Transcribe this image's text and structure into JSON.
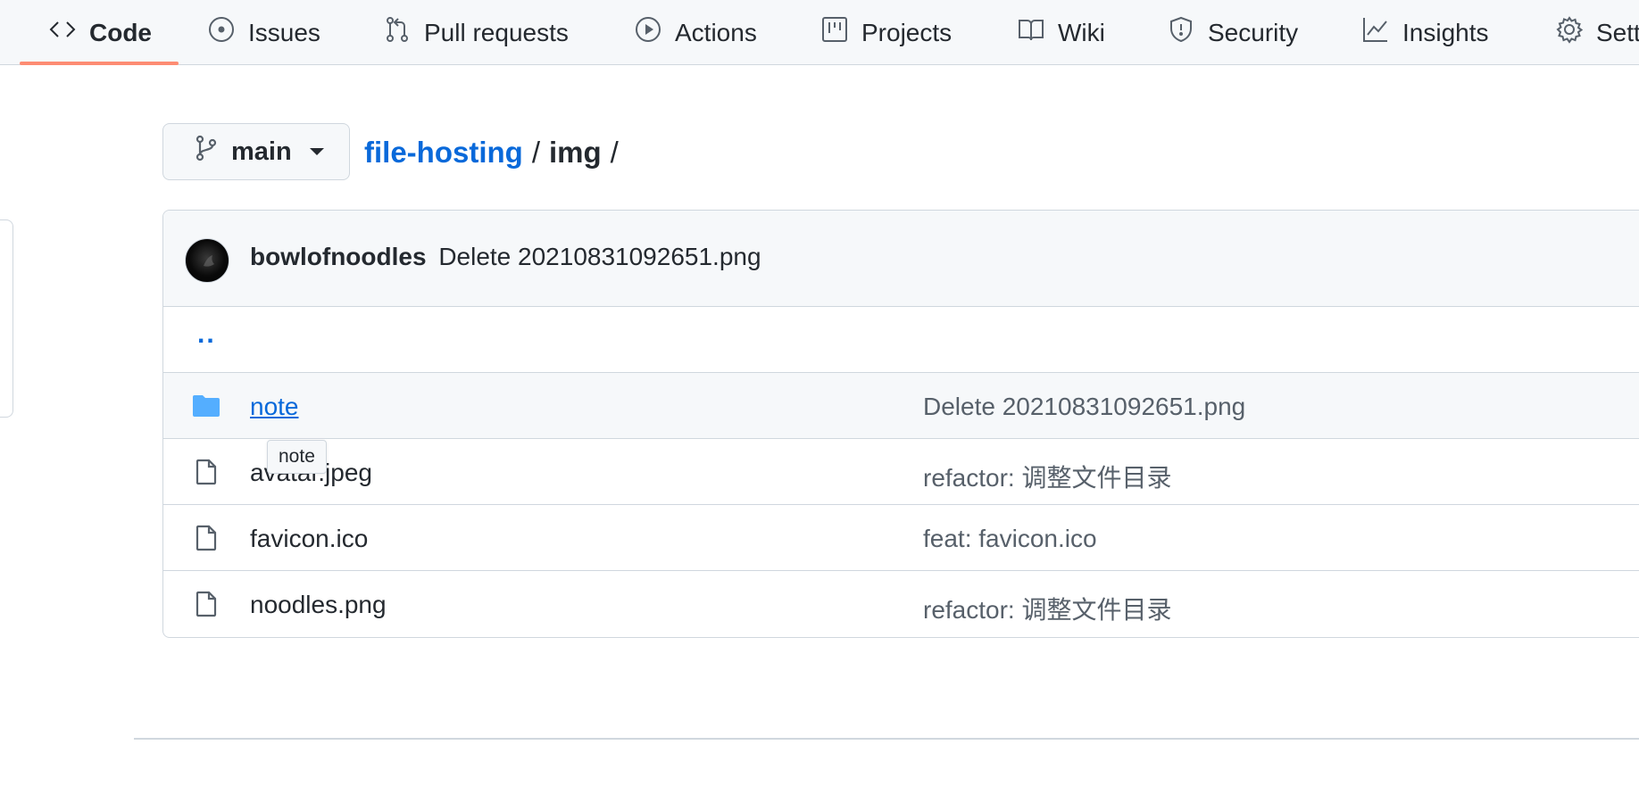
{
  "nav": {
    "tabs": [
      {
        "label": "Code",
        "icon": "code-icon",
        "active": true
      },
      {
        "label": "Issues",
        "icon": "issue-opened-icon"
      },
      {
        "label": "Pull requests",
        "icon": "git-pull-request-icon"
      },
      {
        "label": "Actions",
        "icon": "play-icon"
      },
      {
        "label": "Projects",
        "icon": "project-icon"
      },
      {
        "label": "Wiki",
        "icon": "book-icon"
      },
      {
        "label": "Security",
        "icon": "shield-icon"
      },
      {
        "label": "Insights",
        "icon": "graph-icon"
      },
      {
        "label": "Sett",
        "icon": "gear-icon"
      }
    ],
    "accent_color": "#fd8c73"
  },
  "branch": {
    "label": "main",
    "icon": "git-branch-icon"
  },
  "breadcrumb": {
    "repo": "file-hosting",
    "separator": "/",
    "folder": "img",
    "trailing_separator": "/"
  },
  "commit": {
    "author": "bowlofnoodles",
    "message": "Delete 20210831092651.png"
  },
  "files": {
    "parent_dir": "..",
    "rows": [
      {
        "name": "note",
        "type": "directory",
        "message": "Delete 20210831092651.png"
      },
      {
        "name": "avatar.jpeg",
        "type": "file",
        "message": "refactor: 调整文件目录"
      },
      {
        "name": "favicon.ico",
        "type": "file",
        "message": "feat: favicon.ico"
      },
      {
        "name": "noodles.png",
        "type": "file",
        "message": "refactor: 调整文件目录"
      }
    ]
  },
  "tooltip": {
    "text": "note"
  },
  "colors": {
    "link": "#0969da",
    "folder": "#54aeff",
    "border": "#d0d7de",
    "muted": "#57606a"
  }
}
